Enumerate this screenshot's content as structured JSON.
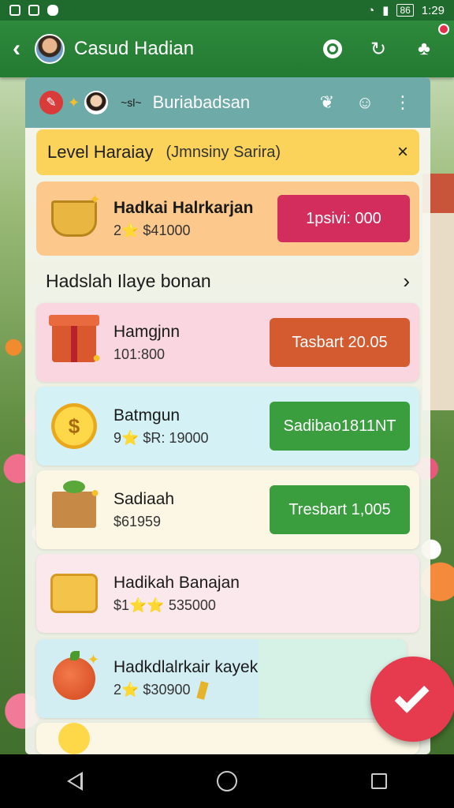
{
  "status_bar": {
    "time": "1:29",
    "battery": "86"
  },
  "app_bar": {
    "title": "Casud Hadian"
  },
  "sub_header": {
    "title": "Buriabadsan",
    "tiny_text": "~sl~"
  },
  "banner": {
    "title": "Level Haraiay",
    "subtitle": "(Jmnsiny Sarira)",
    "close": "×"
  },
  "featured": {
    "title": "Hadkai Halrkarjan",
    "subtitle": "2⭐ $41000",
    "button": "1psivi: 000"
  },
  "section": {
    "title": "Hadslah Ilaye bonan",
    "chevron": "›"
  },
  "items": [
    {
      "title": "Hamgjnn",
      "subtitle": "101:800",
      "button": "Tasbart 20.05"
    },
    {
      "title": "Batmgun",
      "subtitle": "9⭐ $R: 19000",
      "button": "Sadibao1811NT"
    },
    {
      "title": "Sadiaah",
      "subtitle": "$61959",
      "button": "Tresbart 1,005"
    },
    {
      "title": "Hadikah Banajan",
      "subtitle": "$1⭐⭐ 535000"
    },
    {
      "title": "Hadkdlalrkair kayek",
      "subtitle": "2⭐ $30900"
    }
  ],
  "colors": {
    "app_bar": "#2e8a3c",
    "banner": "#fbd35a",
    "featured": "#fcc88c",
    "fab": "#e63a4e"
  }
}
